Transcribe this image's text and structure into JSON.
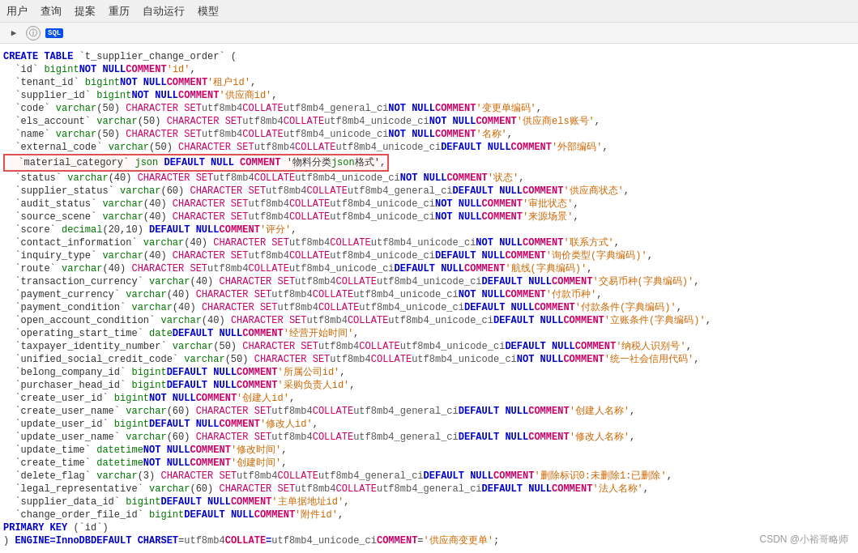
{
  "topbar": {
    "items": [
      "用户",
      "查询",
      "提案",
      "重历",
      "自动运行",
      "模型"
    ]
  },
  "toolbar": {
    "info_icon": "ⓘ",
    "sql_icon": "SQL"
  },
  "code": {
    "lines": [
      {
        "id": 1,
        "text": "CREATE TABLE `t_supplier_change_order` (",
        "highlight": false
      },
      {
        "id": 2,
        "text": "  `id` bigint NOT NULL COMMENT 'id',",
        "highlight": false
      },
      {
        "id": 3,
        "text": "  `tenant_id` bigint NOT NULL COMMENT '租户id',",
        "highlight": false
      },
      {
        "id": 4,
        "text": "  `supplier_id` bigint NOT NULL COMMENT '供应商id',",
        "highlight": false
      },
      {
        "id": 5,
        "text": "  `code` varchar(50) CHARACTER SET utf8mb4 COLLATE utf8mb4_general_ci NOT NULL COMMENT '变更单编码',",
        "highlight": false
      },
      {
        "id": 6,
        "text": "  `els_account` varchar(50) CHARACTER SET utf8mb4 COLLATE utf8mb4_unicode_ci NOT NULL COMMENT '供应商els账号',",
        "highlight": false
      },
      {
        "id": 7,
        "text": "  `name` varchar(50) CHARACTER SET utf8mb4 COLLATE utf8mb4_unicode_ci NOT NULL COMMENT '名称',",
        "highlight": false
      },
      {
        "id": 8,
        "text": "  `external_code` varchar(50) CHARACTER SET utf8mb4 COLLATE utf8mb4_unicode_ci DEFAULT NULL COMMENT '外部编码',",
        "highlight": false
      },
      {
        "id": 9,
        "text": "  `material_category` json DEFAULT NULL COMMENT '物料分类json格式',",
        "highlight": true
      },
      {
        "id": 10,
        "text": "  `status` varchar(40) CHARACTER SET utf8mb4 COLLATE utf8mb4_unicode_ci NOT NULL COMMENT '状态',",
        "highlight": false
      },
      {
        "id": 11,
        "text": "  `supplier_status` varchar(60) CHARACTER SET utf8mb4 COLLATE utf8mb4_general_ci DEFAULT NULL COMMENT '供应商状态',",
        "highlight": false
      },
      {
        "id": 12,
        "text": "  `audit_status` varchar(40) CHARACTER SET utf8mb4 COLLATE utf8mb4_unicode_ci NOT NULL COMMENT '审批状态',",
        "highlight": false
      },
      {
        "id": 13,
        "text": "  `source_scene` varchar(40) CHARACTER SET utf8mb4 COLLATE utf8mb4_unicode_ci NOT NULL COMMENT '来源场景',",
        "highlight": false
      },
      {
        "id": 14,
        "text": "  `score` decimal(20,10) DEFAULT NULL COMMENT '评分',",
        "highlight": false
      },
      {
        "id": 15,
        "text": "  `contact_information` varchar(40) CHARACTER SET utf8mb4 COLLATE utf8mb4_unicode_ci NOT NULL COMMENT '联系方式',",
        "highlight": false
      },
      {
        "id": 16,
        "text": "  `inquiry_type` varchar(40) CHARACTER SET utf8mb4 COLLATE utf8mb4_unicode_ci DEFAULT NULL COMMENT '询价类型(字典编码)',",
        "highlight": false
      },
      {
        "id": 17,
        "text": "  `route` varchar(40) CHARACTER SET utf8mb4 COLLATE utf8mb4_unicode_ci DEFAULT NULL COMMENT '航线(字典编码)',",
        "highlight": false
      },
      {
        "id": 18,
        "text": "  `transaction_currency` varchar(40) CHARACTER SET utf8mb4 COLLATE utf8mb4_unicode_ci DEFAULT NULL COMMENT '交易币种(字典编码)',",
        "highlight": false
      },
      {
        "id": 19,
        "text": "  `payment_currency` varchar(40) CHARACTER SET utf8mb4 COLLATE utf8mb4_unicode_ci NOT NULL COMMENT '付款币种',",
        "highlight": false
      },
      {
        "id": 20,
        "text": "  `payment_condition` varchar(40) CHARACTER SET utf8mb4 COLLATE utf8mb4_unicode_ci DEFAULT NULL COMMENT '付款条件(字典编码)',",
        "highlight": false
      },
      {
        "id": 21,
        "text": "  `open_account_condition` varchar(40) CHARACTER SET utf8mb4 COLLATE utf8mb4_unicode_ci DEFAULT NULL COMMENT '立账条件(字典编码)',",
        "highlight": false
      },
      {
        "id": 22,
        "text": "  `operating_start_time` date DEFAULT NULL COMMENT '经营开始时间',",
        "highlight": false
      },
      {
        "id": 23,
        "text": "  `taxpayer_identity_number` varchar(50) CHARACTER SET utf8mb4 COLLATE utf8mb4_unicode_ci DEFAULT NULL COMMENT '纳税人识别号',",
        "highlight": false
      },
      {
        "id": 24,
        "text": "  `unified_social_credit_code` varchar(50) CHARACTER SET utf8mb4 COLLATE utf8mb4_unicode_ci NOT NULL COMMENT '统一社会信用代码',",
        "highlight": false
      },
      {
        "id": 25,
        "text": "  `belong_company_id` bigint DEFAULT NULL COMMENT '所属公司id',",
        "highlight": false
      },
      {
        "id": 26,
        "text": "  `purchaser_head_id` bigint DEFAULT NULL COMMENT '采购负责人id',",
        "highlight": false
      },
      {
        "id": 27,
        "text": "  `create_user_id` bigint NOT NULL COMMENT '创建人id',",
        "highlight": false
      },
      {
        "id": 28,
        "text": "  `create_user_name` varchar(60) CHARACTER SET utf8mb4 COLLATE utf8mb4_general_ci DEFAULT NULL COMMENT '创建人名称',",
        "highlight": false
      },
      {
        "id": 29,
        "text": "  `update_user_id` bigint DEFAULT NULL COMMENT '修改人id',",
        "highlight": false
      },
      {
        "id": 30,
        "text": "  `update_user_name` varchar(60) CHARACTER SET utf8mb4 COLLATE utf8mb4_general_ci DEFAULT NULL COMMENT '修改人名称',",
        "highlight": false
      },
      {
        "id": 31,
        "text": "  `update_time` datetime NOT NULL COMMENT '修改时间',",
        "highlight": false
      },
      {
        "id": 32,
        "text": "  `create_time` datetime NOT NULL COMMENT '创建时间',",
        "highlight": false
      },
      {
        "id": 33,
        "text": "  `delete_flag` varchar(3) CHARACTER SET utf8mb4 COLLATE utf8mb4_general_ci DEFAULT NULL COMMENT '删除标识0:未删除1:已删除',",
        "highlight": false
      },
      {
        "id": 34,
        "text": "  `legal_representative` varchar(60) CHARACTER SET utf8mb4 COLLATE utf8mb4_general_ci DEFAULT NULL COMMENT '法人名称',",
        "highlight": false
      },
      {
        "id": 35,
        "text": "  `supplier_data_id` bigint DEFAULT NULL COMMENT '主单据地址id',",
        "highlight": false
      },
      {
        "id": 36,
        "text": "  `change_order_file_id` bigint DEFAULT NULL COMMENT '附件id',",
        "highlight": false
      },
      {
        "id": 37,
        "text": "  PRIMARY KEY (`id`)",
        "highlight": false
      },
      {
        "id": 38,
        "text": ") ENGINE=InnoDB DEFAULT CHARSET=utf8mb4 COLLATE=utf8mb4_unicode_ci COMMENT='供应商变更单';",
        "highlight": false
      }
    ]
  },
  "watermark": {
    "text": "CSDN @小裕哥略师"
  }
}
